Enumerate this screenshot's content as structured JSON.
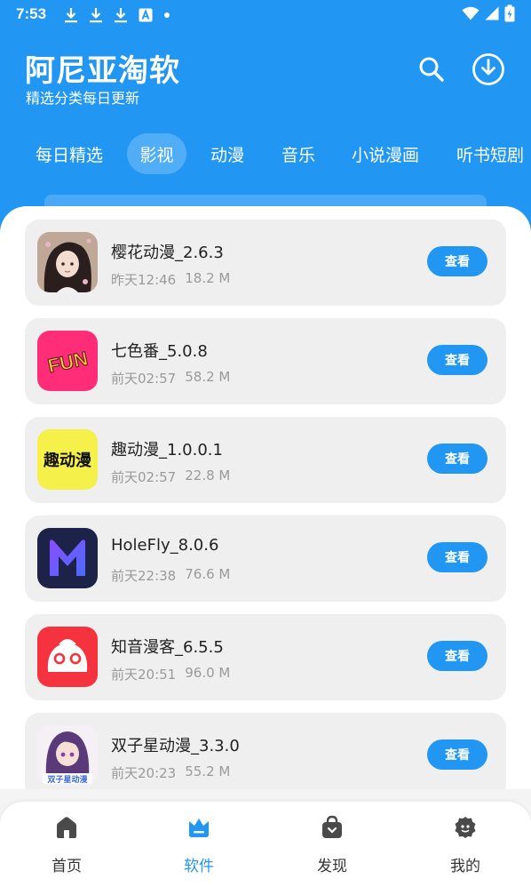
{
  "status_bar": {
    "time": "7:53"
  },
  "header": {
    "title": "阿尼亚淘软",
    "subtitle": "精选分类每日更新",
    "search_icon": "search-icon",
    "download_icon": "download-icon"
  },
  "tabs": [
    {
      "label": "每日精选",
      "active": false
    },
    {
      "label": "影视",
      "active": true
    },
    {
      "label": "动漫",
      "active": false
    },
    {
      "label": "音乐",
      "active": false
    },
    {
      "label": "小说漫画",
      "active": false
    },
    {
      "label": "听书短剧",
      "active": false
    }
  ],
  "apps": [
    {
      "title": "樱花动漫_2.6.3",
      "time": "昨天12:46",
      "size": "18.2 M",
      "button": "查看",
      "icon": "sakura-anime-icon"
    },
    {
      "title": "七色番_5.0.8",
      "time": "前天02:57",
      "size": "58.2 M",
      "button": "查看",
      "icon": "fun-icon",
      "icon_text": "FUN"
    },
    {
      "title": "趣动漫_1.0.0.1",
      "time": "前天02:57",
      "size": "22.8 M",
      "button": "查看",
      "icon": "qu-dongman-icon",
      "icon_text": "趣动漫"
    },
    {
      "title": "HoleFly_8.0.6",
      "time": "前天22:38",
      "size": "76.6 M",
      "button": "查看",
      "icon": "holefly-m-icon"
    },
    {
      "title": "知音漫客_6.5.5",
      "time": "前天20:51",
      "size": "96.0 M",
      "button": "查看",
      "icon": "zhiyin-mascot-icon"
    },
    {
      "title": "双子星动漫_3.3.0",
      "time": "前天20:23",
      "size": "55.2 M",
      "button": "查看",
      "icon": "gemini-anime-icon",
      "icon_text": "双子星动漫"
    }
  ],
  "bottom_nav": [
    {
      "label": "首页",
      "icon": "home-icon",
      "active": false
    },
    {
      "label": "软件",
      "icon": "crown-icon",
      "active": true
    },
    {
      "label": "发现",
      "icon": "bag-icon",
      "active": false
    },
    {
      "label": "我的",
      "icon": "profile-icon",
      "active": false
    }
  ],
  "colors": {
    "primary": "#2196f3",
    "card_bg": "#efeff0",
    "meta_text": "#9a9a9a"
  }
}
